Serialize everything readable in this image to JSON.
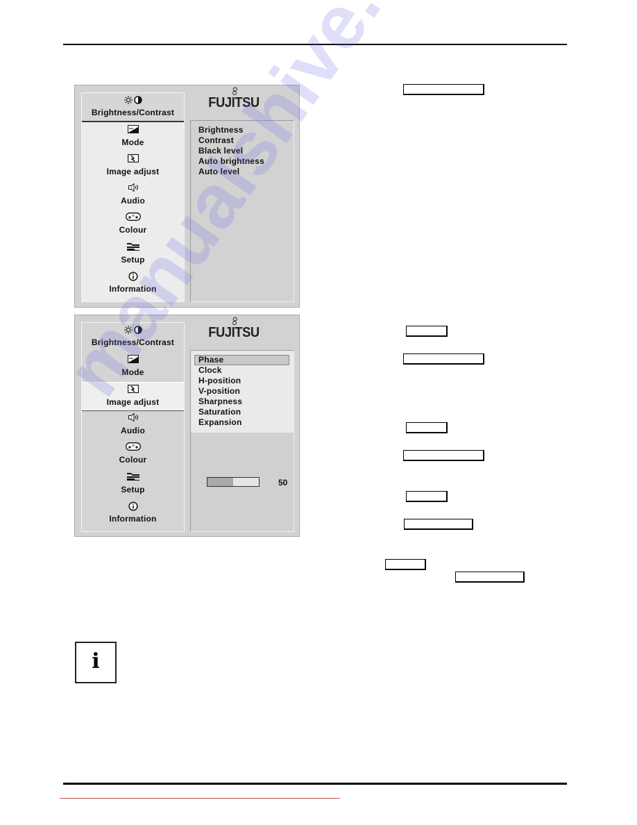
{
  "logo": "FUJITSU",
  "osd_panel_1": {
    "menu": [
      {
        "icon": "brightness-contrast-icon",
        "label": "Brightness/Contrast",
        "active": true
      },
      {
        "icon": "mode-icon",
        "label": "Mode"
      },
      {
        "icon": "image-adjust-icon",
        "label": "Image adjust"
      },
      {
        "icon": "audio-icon",
        "label": "Audio"
      },
      {
        "icon": "colour-icon",
        "label": "Colour"
      },
      {
        "icon": "setup-icon",
        "label": "Setup"
      },
      {
        "icon": "information-icon",
        "label": "Information"
      }
    ],
    "submenu": [
      "Brightness",
      "Contrast",
      "Black level",
      "Auto brightness",
      "Auto level"
    ]
  },
  "osd_panel_2": {
    "menu": [
      {
        "icon": "brightness-contrast-icon",
        "label": "Brightness/Contrast"
      },
      {
        "icon": "mode-icon",
        "label": "Mode"
      },
      {
        "icon": "image-adjust-icon",
        "label": "Image adjust",
        "active": true
      },
      {
        "icon": "audio-icon",
        "label": "Audio"
      },
      {
        "icon": "colour-icon",
        "label": "Colour"
      },
      {
        "icon": "setup-icon",
        "label": "Setup"
      },
      {
        "icon": "information-icon",
        "label": "Information"
      }
    ],
    "submenu": [
      "Phase",
      "Clock",
      "H-position",
      "V-position",
      "Sharpness",
      "Saturation",
      "Expansion"
    ],
    "selected_item": "Phase",
    "slider": {
      "value": 50,
      "max": 100,
      "value_label": "50"
    }
  },
  "note_icon": "i",
  "watermark": "manualshive.com"
}
